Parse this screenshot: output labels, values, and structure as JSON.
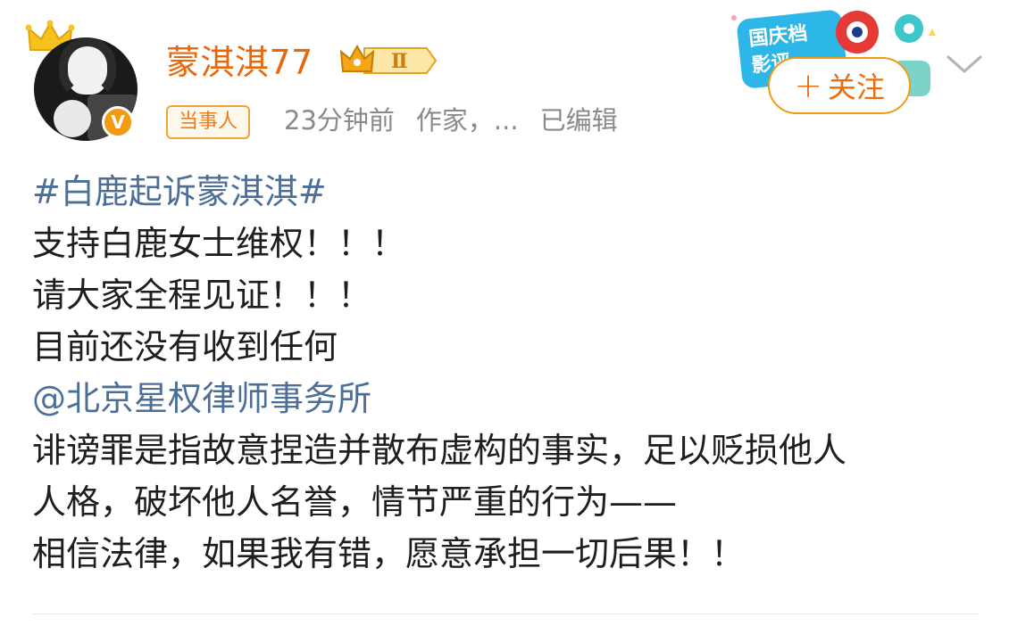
{
  "header": {
    "username": "蒙淇淇77",
    "level_badge": "Ⅱ",
    "verified_mark": "V",
    "tag": "当事人",
    "time": "23分钟前",
    "description": "作家，...",
    "edited": "已编辑",
    "follow_label": "关注",
    "follow_plus": "+"
  },
  "post": {
    "hashtag": "#白鹿起诉蒙淇淇#",
    "line1": "支持白鹿女士维权！！！",
    "line2": "请大家全程见证！！！",
    "line3": "目前还没有收到任何",
    "mention": "@北京星权律师事务所",
    "line4": "诽谤罪是指故意捏造并散布虚构的事实，足以贬损他人",
    "line5": "人格，破坏他人名誉，情节严重的行为——",
    "line6": "相信法律，如果我有错，愿意承担一切后果！！"
  },
  "sticker": {
    "text_line1": "国庆档",
    "text_line2": "影评"
  },
  "colors": {
    "username": "#e8670a",
    "accent": "#f39a13",
    "link": "#4d6e96",
    "meta": "#8a8a8a"
  },
  "icons": [
    "crown-icon",
    "verified-v-icon",
    "level-crown-icon",
    "chevron-down-icon"
  ]
}
